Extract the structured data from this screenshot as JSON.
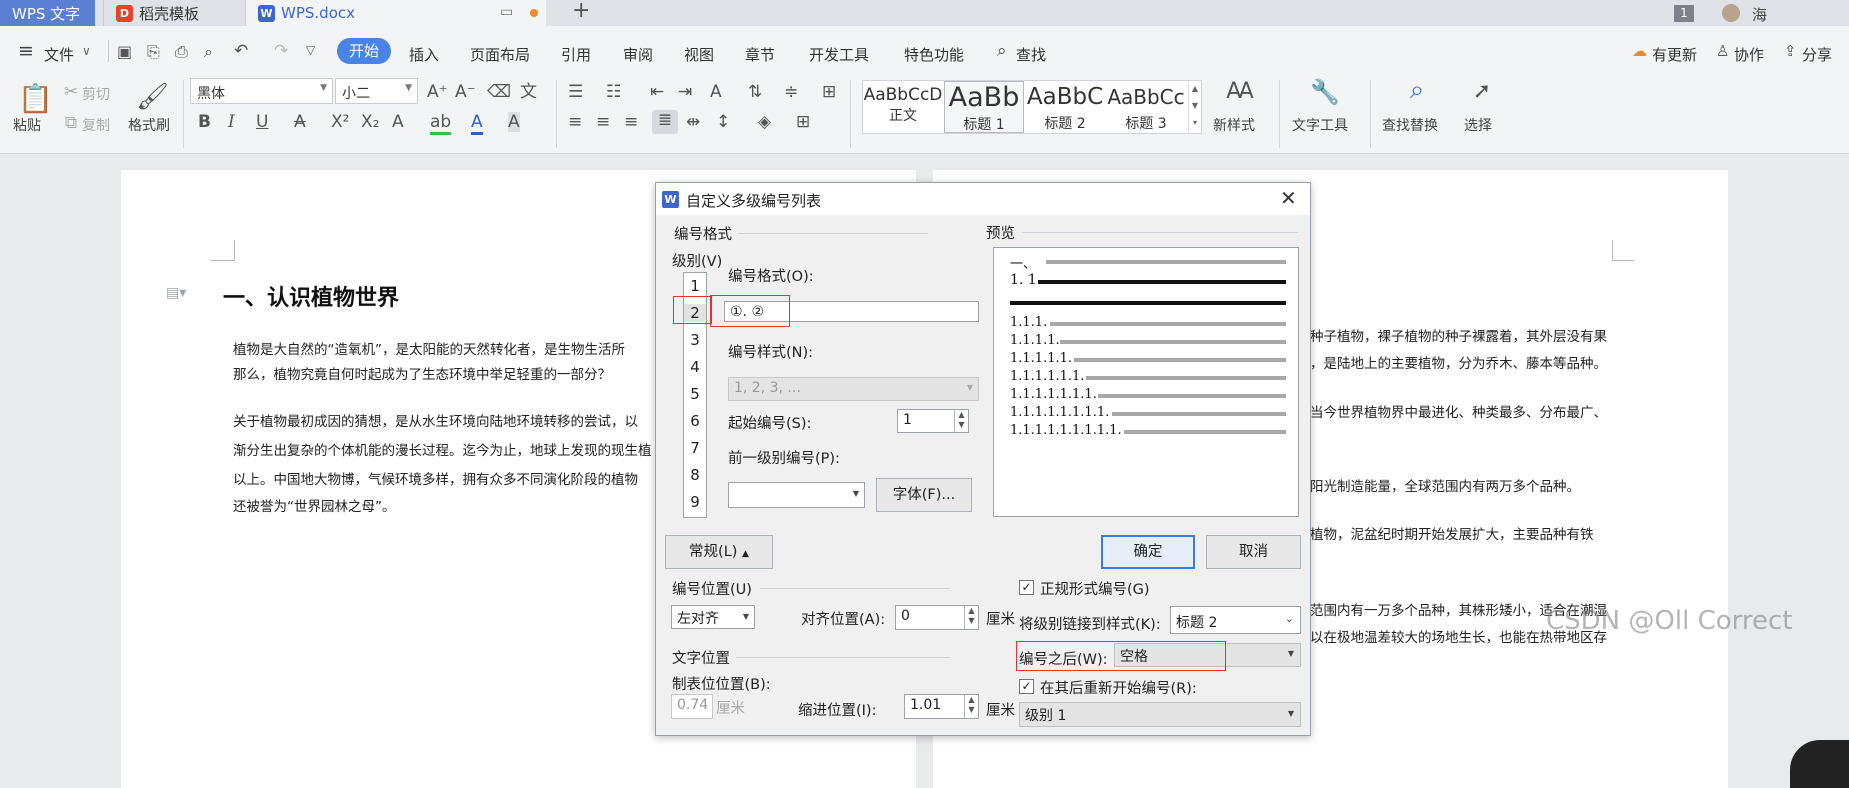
{
  "tabs": {
    "wps": "WPS 文字",
    "template": "稻壳模板",
    "doc": "WPS.docx",
    "badge": "1",
    "user": "海"
  },
  "menu": {
    "file": "文件",
    "items": [
      "开始",
      "插入",
      "页面布局",
      "引用",
      "审阅",
      "视图",
      "章节",
      "开发工具",
      "特色功能"
    ],
    "search": "查找",
    "right": [
      "有更新",
      "协作",
      "分享"
    ]
  },
  "ribbon": {
    "paste": "粘贴",
    "cut": "剪切",
    "copy": "复制",
    "format_painter": "格式刷",
    "font": "黑体",
    "size": "小二",
    "styles": [
      {
        "preview": "AaBbCcD",
        "label": "正文"
      },
      {
        "preview": "AaBb",
        "label": "标题 1"
      },
      {
        "preview": "AaBbC",
        "label": "标题 2"
      },
      {
        "preview": "AaBbCc",
        "label": "标题 3"
      }
    ],
    "new_style": "新样式",
    "text_tools": "文字工具",
    "find_replace": "查找替换",
    "select": "选择"
  },
  "doc": {
    "heading": "一、认识植物世界",
    "left_lines": [
      "植物是大自然的“造氧机”，是太阳能的天然转化者，是生物生活所",
      "那么，植物究竟自何时起成为了生态环境中举足轻重的一部分？",
      "关于植物最初成因的猜想，是从水生环境向陆地环境转移的尝试，以",
      "渐分生出复杂的个体机能的漫长过程。迄今为止，地球上发现的现生植",
      "以上。中国地大物博，气候环境多样，拥有众多不同演化阶段的植物",
      "还被誉为“世界园林之母”。"
    ],
    "right_lines": [
      "种子植物，裸子植物的种子裸露着，其外层没有果",
      "，是陆地上的主要植物，分为乔木、藤本等品种。",
      "当今世界植物界中最进化、种类最多、分布最广、",
      "阳光制造能量，全球范围内有两万多个品种。",
      "植物，泥盆纪时期开始发展扩大，主要品种有铁",
      "范围内有一万多个品种，其株形矮小，适合在潮湿",
      "以在极地温差较大的场地生长，也能在热带地区存"
    ]
  },
  "dialog": {
    "title": "自定义多级编号列表",
    "numbering_format_group": "编号格式",
    "level_label": "级别(V)",
    "levels": [
      "1",
      "2",
      "3",
      "4",
      "5",
      "6",
      "7",
      "8",
      "9"
    ],
    "format_label": "编号格式(O):",
    "format_value": "①. ②",
    "style_label": "编号样式(N):",
    "style_value": "1, 2, 3, ...",
    "start_label": "起始编号(S):",
    "start_value": "1",
    "prev_level_label": "前一级别编号(P):",
    "font_button": "字体(F)...",
    "preview_label": "预览",
    "preview_numbers": [
      "一、",
      "1. 1",
      "1.1.1.",
      "1.1.1.1.",
      "1.1.1.1.1.",
      "1.1.1.1.1.1.",
      "1.1.1.1.1.1.1.",
      "1.1.1.1.1.1.1.1.",
      "1.1.1.1.1.1.1.1.1."
    ],
    "general_button": "常规(L)",
    "ok": "确定",
    "cancel": "取消",
    "number_position_group": "编号位置(U)",
    "align_value": "左对齐",
    "align_pos_label": "对齐位置(A):",
    "align_pos_value": "0",
    "unit": "厘米",
    "text_position_group": "文字位置",
    "tab_pos_label": "制表位位置(B):",
    "tab_pos_value": "0.74",
    "indent_label": "缩进位置(I):",
    "indent_value": "1.01",
    "legal_label": "正规形式编号(G)",
    "link_label": "将级别链接到样式(K):",
    "link_value": "标题 2",
    "after_label": "编号之后(W):",
    "after_value": "空格",
    "restart_label": "在其后重新开始编号(R):",
    "restart_value": "级别 1"
  },
  "watermark": "CSDN @Oll Correct"
}
